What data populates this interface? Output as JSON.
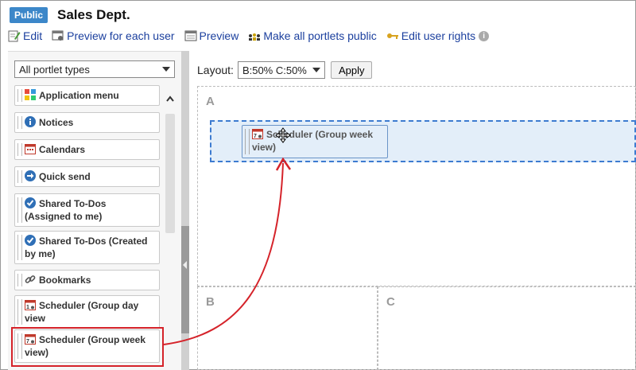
{
  "header": {
    "badge": "Public",
    "title": "Sales Dept."
  },
  "toolbar": {
    "edit": "Edit",
    "preview_each": "Preview for each user",
    "preview": "Preview",
    "make_public": "Make all portlets public",
    "edit_rights": "Edit user rights"
  },
  "sidebar": {
    "type_filter": "All portlet types",
    "items": [
      {
        "label": "Application menu",
        "icon": "app-menu-icon"
      },
      {
        "label": "Notices",
        "icon": "info-icon"
      },
      {
        "label": "Calendars",
        "icon": "calendar-icon"
      },
      {
        "label": "Quick send",
        "icon": "send-icon"
      },
      {
        "label": "Shared To-Dos (Assigned to me)",
        "icon": "todo-icon"
      },
      {
        "label": "Shared To-Dos (Created by me)",
        "icon": "todo-icon"
      },
      {
        "label": "Bookmarks",
        "icon": "link-icon"
      },
      {
        "label": "Scheduler (Group day view",
        "icon": "scheduler-icon"
      },
      {
        "label": "Scheduler (Group week view)",
        "icon": "scheduler-icon"
      }
    ]
  },
  "layout": {
    "label": "Layout:",
    "value": "B:50% C:50%",
    "apply": "Apply"
  },
  "zones": {
    "a": "A",
    "b": "B",
    "c": "C"
  },
  "dragging": {
    "label": "Scheduler (Group week view)"
  },
  "colors": {
    "accent": "#3c87c9",
    "link": "#1b3f9e",
    "highlight": "#d5232a",
    "drop": "#3d7bd0"
  }
}
